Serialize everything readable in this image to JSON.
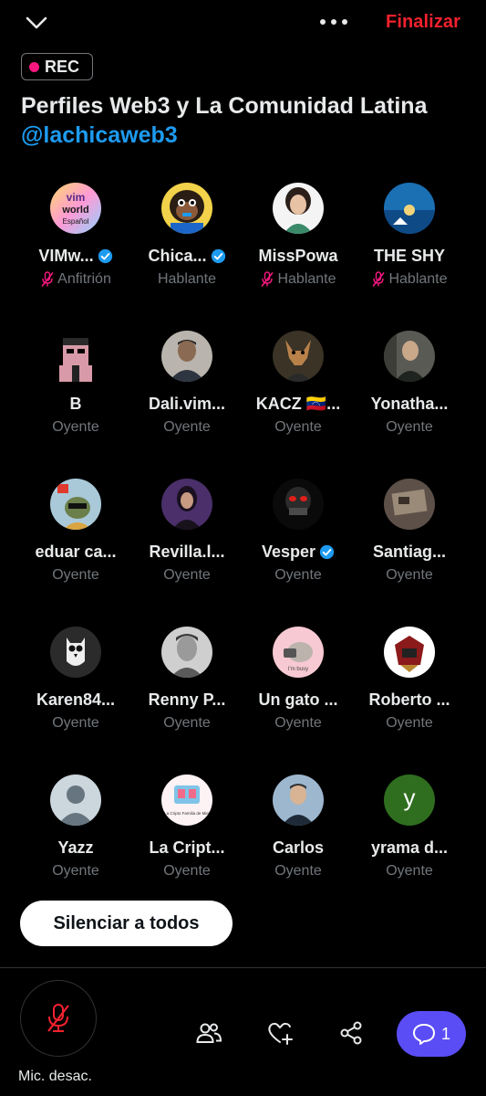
{
  "header": {
    "end_label": "Finalizar",
    "collapse_icon": "chevron-down-icon",
    "more_icon": "more-dots-icon",
    "end_color": "#f4212e"
  },
  "recording": {
    "label": "REC",
    "dot_color": "#f91880"
  },
  "space": {
    "title": "Perfiles Web3 y La Comunidad Latina",
    "host_handle": "@lachicaweb3"
  },
  "participants": [
    {
      "name": "VIMw...",
      "role": "Anfitrión",
      "verified": true,
      "mic_off": true
    },
    {
      "name": "Chica...",
      "role": "Hablante",
      "verified": true,
      "mic_off": false
    },
    {
      "name": "MissPowa",
      "role": "Hablante",
      "verified": false,
      "mic_off": true
    },
    {
      "name": "THE SHY",
      "role": "Hablante",
      "verified": false,
      "mic_off": true
    },
    {
      "name": "B",
      "role": "Oyente",
      "verified": false,
      "mic_off": false
    },
    {
      "name": "Dali.vim...",
      "role": "Oyente",
      "verified": false,
      "mic_off": false
    },
    {
      "name": "KACZ 🇻🇪...",
      "role": "Oyente",
      "verified": false,
      "mic_off": false
    },
    {
      "name": "Yonatha...",
      "role": "Oyente",
      "verified": false,
      "mic_off": false
    },
    {
      "name": "eduar ca...",
      "role": "Oyente",
      "verified": false,
      "mic_off": false
    },
    {
      "name": "Revilla.l...",
      "role": "Oyente",
      "verified": false,
      "mic_off": false
    },
    {
      "name": "Vesper",
      "role": "Oyente",
      "verified": true,
      "mic_off": false
    },
    {
      "name": "Santiag...",
      "role": "Oyente",
      "verified": false,
      "mic_off": false
    },
    {
      "name": "Karen84...",
      "role": "Oyente",
      "verified": false,
      "mic_off": false
    },
    {
      "name": "Renny P...",
      "role": "Oyente",
      "verified": false,
      "mic_off": false
    },
    {
      "name": "Un gato ...",
      "role": "Oyente",
      "verified": false,
      "mic_off": false
    },
    {
      "name": "Roberto ...",
      "role": "Oyente",
      "verified": false,
      "mic_off": false
    },
    {
      "name": "Yazz",
      "role": "Oyente",
      "verified": false,
      "mic_off": false
    },
    {
      "name": "La Cript...",
      "role": "Oyente",
      "verified": false,
      "mic_off": false
    },
    {
      "name": "Carlos",
      "role": "Oyente",
      "verified": false,
      "mic_off": false
    },
    {
      "name": "yrama d...",
      "role": "Oyente",
      "verified": false,
      "mic_off": false
    }
  ],
  "avatars": {
    "vim_lines": [
      "vim",
      "world",
      "Español"
    ],
    "pusheen_caption": "I'm busy",
    "yrama_letter": "y",
    "cripto_caption": "La Cripto Familia de Miel"
  },
  "actions": {
    "mute_all": "Silenciar a todos"
  },
  "bottom_bar": {
    "mic_label": "Mic. desac.",
    "mic_icon": "mic-off-icon",
    "people_icon": "people-icon",
    "heart_icon": "heart-plus-icon",
    "share_icon": "share-icon",
    "chat_icon": "chat-bubble-icon",
    "chat_count": "1",
    "chat_color": "#5a4df5"
  }
}
